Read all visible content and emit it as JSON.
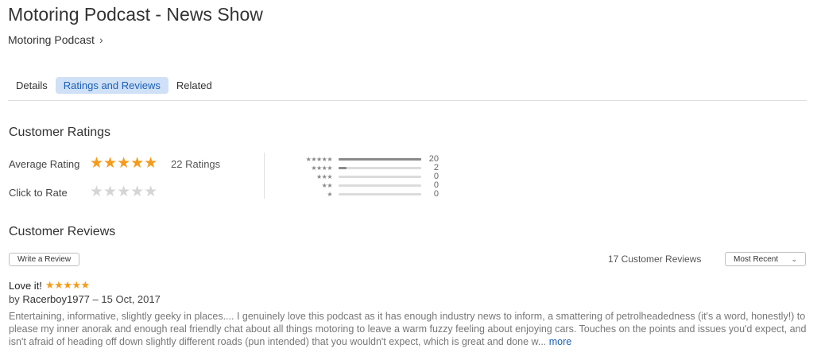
{
  "header": {
    "title": "Motoring Podcast - News Show",
    "artist": "Motoring Podcast"
  },
  "tabs": [
    {
      "label": "Details",
      "active": false
    },
    {
      "label": "Ratings and Reviews",
      "active": true
    },
    {
      "label": "Related",
      "active": false
    }
  ],
  "ratings": {
    "section_title": "Customer Ratings",
    "average_label": "Average Rating",
    "average_stars": "★★★★★",
    "ratings_count": "22 Ratings",
    "click_to_rate_label": "Click to Rate",
    "rate_stars": "★★★★★",
    "histogram": [
      {
        "stars": "★★★★★",
        "count": "20",
        "fraction": 1.0
      },
      {
        "stars": "★★★★",
        "count": "2",
        "fraction": 0.1
      },
      {
        "stars": "★★★",
        "count": "0",
        "fraction": 0
      },
      {
        "stars": "★★",
        "count": "0",
        "fraction": 0
      },
      {
        "stars": "★",
        "count": "0",
        "fraction": 0
      }
    ]
  },
  "reviews": {
    "section_title": "Customer Reviews",
    "write_review_label": "Write a Review",
    "count_label": "17 Customer Reviews",
    "sort_selected": "Most Recent",
    "items": [
      {
        "title": "Love it!",
        "stars": "★★★★★",
        "by_prefix": "by",
        "author": "Racerboy1977",
        "date_sep": "–",
        "date": "15 Oct, 2017",
        "body": "Entertaining, informative, slightly geeky in places.... I genuinely love this podcast as it has enough industry news to inform, a smattering of petrolheadedness (it's a word, honestly!) to please my inner anorak and enough real friendly chat about all things motoring to leave a warm fuzzy feeling about enjoying cars. Touches on the points and issues you'd expect, and isn't afraid of heading off down slightly different roads (pun intended) that you wouldn't expect, which is great and done w...",
        "more_label": "more"
      }
    ]
  },
  "colors": {
    "star_filled": "#f59b1b",
    "star_empty": "#d5d5d5",
    "tab_active_bg": "#cfe0f7",
    "link": "#1a5fb4"
  }
}
